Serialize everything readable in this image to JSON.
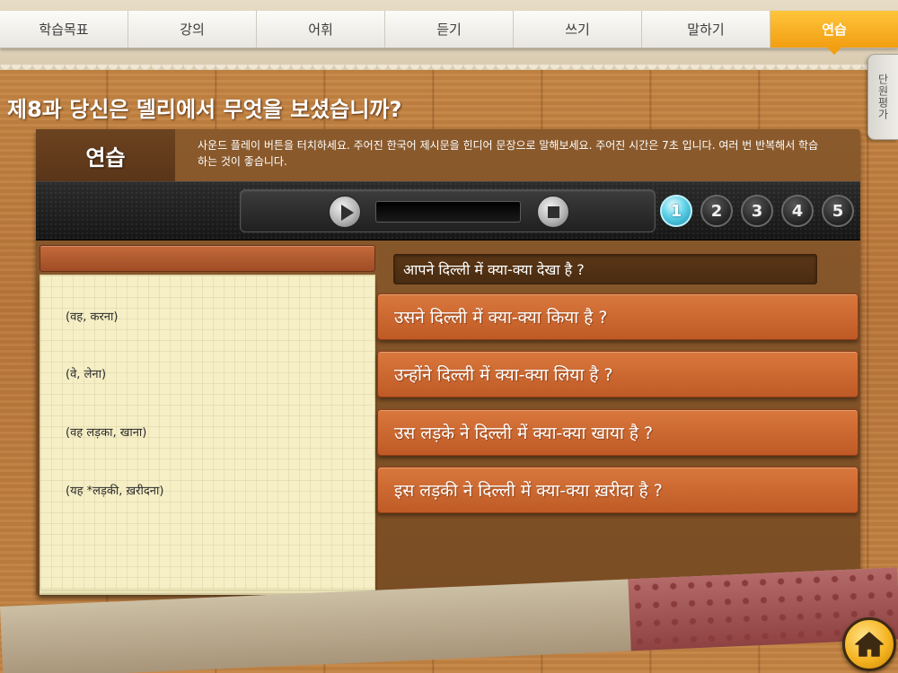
{
  "tabs": [
    {
      "label": "학습목표"
    },
    {
      "label": "강의"
    },
    {
      "label": "어휘"
    },
    {
      "label": "듣기"
    },
    {
      "label": "쓰기"
    },
    {
      "label": "말하기"
    },
    {
      "label": "연습",
      "active": true
    }
  ],
  "side_tab": {
    "label": "단원평가"
  },
  "lesson_title": "제8과 당신은 델리에서 무엇을 보셨습니까?",
  "instruction": {
    "label": "연습",
    "text": "사운드 플레이 버튼을 터치하세요. 주어진 한국어 제시문을 힌디어 문장으로 말해보세요. 주어진 시간은 7초 입니다. 여러 번 반복해서 학습하는 것이 좋습니다."
  },
  "player": {
    "play_icon": "play-icon",
    "stop_icon": "stop-icon",
    "progress": 0
  },
  "numbers": [
    "1",
    "2",
    "3",
    "4",
    "5"
  ],
  "active_number": "1",
  "hints": [
    "(वह, करना)",
    "(वे, लेना)",
    "(वह लड़का, खाना)",
    "(यह *लड़की, ख़रीदना)"
  ],
  "question": "आपने दिल्ली में क्या-क्या देखा है ?",
  "options": [
    "उसने दिल्ली में क्या-क्या किया है ?",
    "उन्होंने दिल्ली में क्या-क्या लिया है ?",
    "उस लड़के ने दिल्ली में क्या-क्या खाया है ?",
    "इस लड़की ने दिल्ली में क्या-क्या ख़रीदा है ?"
  ],
  "home_icon": "home-icon",
  "colors": {
    "accent": "#f29e12",
    "option": "#c9632d",
    "active_number": "#5fd2e8"
  }
}
